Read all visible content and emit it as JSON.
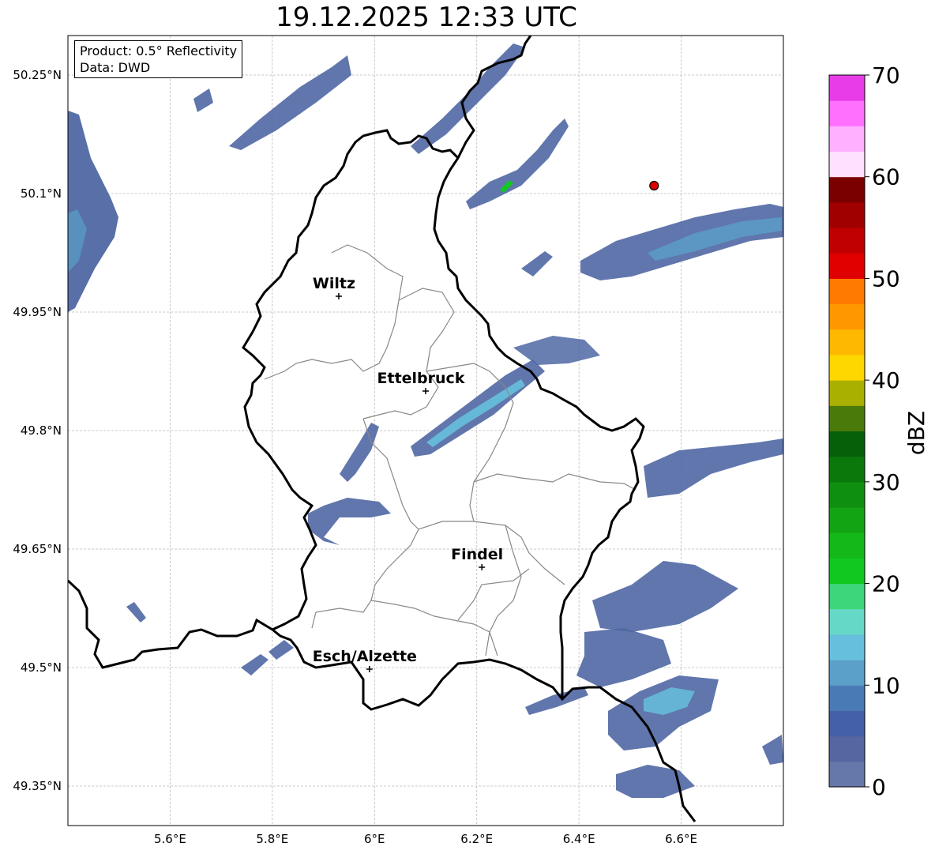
{
  "title": "19.12.2025 12:33 UTC",
  "info": {
    "product": "Product: 0.5° Reflectivity",
    "data": "Data: DWD"
  },
  "map": {
    "lon_range": [
      5.4,
      6.8
    ],
    "lat_range": [
      49.3,
      50.3
    ],
    "x_ticks": [
      {
        "value": 5.6,
        "label": "5.6°E"
      },
      {
        "value": 5.8,
        "label": "5.8°E"
      },
      {
        "value": 6.0,
        "label": "6°E"
      },
      {
        "value": 6.2,
        "label": "6.2°E"
      },
      {
        "value": 6.4,
        "label": "6.4°E"
      },
      {
        "value": 6.6,
        "label": "6.6°E"
      }
    ],
    "y_ticks": [
      {
        "value": 50.25,
        "label": "50.25°N"
      },
      {
        "value": 50.1,
        "label": "50.1°N"
      },
      {
        "value": 49.95,
        "label": "49.95°N"
      },
      {
        "value": 49.8,
        "label": "49.8°N"
      },
      {
        "value": 49.65,
        "label": "49.65°N"
      },
      {
        "value": 49.5,
        "label": "49.5°N"
      },
      {
        "value": 49.35,
        "label": "49.35°N"
      }
    ],
    "cities": [
      {
        "name": "Wiltz",
        "lon": 5.93,
        "lat": 49.97
      },
      {
        "name": "Ettelbruck",
        "lon": 6.1,
        "lat": 49.85
      },
      {
        "name": "Findel",
        "lon": 6.21,
        "lat": 49.627
      },
      {
        "name": "Esch/Alzette",
        "lon": 5.99,
        "lat": 49.498
      }
    ],
    "radar_site": {
      "lon": 6.547,
      "lat": 50.11,
      "color": "#e00000"
    }
  },
  "colorbar": {
    "label": "dBZ",
    "min": 0,
    "max": 70,
    "ticks": [
      0,
      10,
      20,
      30,
      40,
      50,
      60,
      70
    ],
    "colors": [
      "#6677aa",
      "#5566a0",
      "#4460a8",
      "#4a7ab5",
      "#5aa0c8",
      "#66c0dd",
      "#66d8c8",
      "#3dd67a",
      "#10c820",
      "#14b818",
      "#12a412",
      "#0f8f10",
      "#0b780c",
      "#06600a",
      "#4a7a0a",
      "#aab000",
      "#ffd700",
      "#ffb800",
      "#ff9800",
      "#ff7a00",
      "#e00000",
      "#c00000",
      "#a00000",
      "#7a0000",
      "#ffe0ff",
      "#ffb0ff",
      "#ff70ff",
      "#e83ce8"
    ]
  }
}
